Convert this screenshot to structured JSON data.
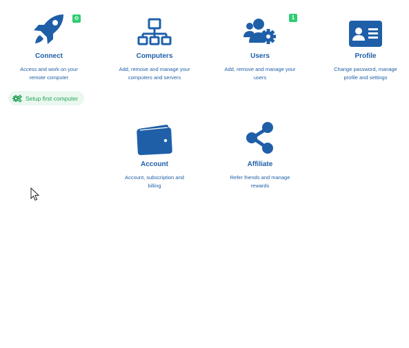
{
  "tiles": {
    "connect": {
      "title": "Connect",
      "desc_line1": "Access and work on your",
      "desc_line2": "remote computer",
      "icon": "rocket-icon",
      "badge": "⚙"
    },
    "computers": {
      "title": "Computers",
      "desc_line1": "Add, remove and manage your",
      "desc_line2": "computers and servers",
      "icon": "network-icon"
    },
    "users": {
      "title": "Users",
      "desc_line1": "Add, remove and manage your",
      "desc_line2": "users",
      "icon": "users-gear-icon",
      "badge": "1"
    },
    "profile": {
      "title": "Profile",
      "desc_line1": "Change password, manage",
      "desc_line2": "profile and settings",
      "icon": "id-card-icon"
    },
    "account": {
      "title": "Account",
      "desc_line1": "Account, subscription and",
      "desc_line2": "billing",
      "icon": "wallet-icon"
    },
    "affiliate": {
      "title": "Affiliate",
      "desc_line1": "Refer friends and manage",
      "desc_line2": "rewards",
      "icon": "share-icon"
    }
  },
  "setup": {
    "label": "Setup first computer",
    "icon": "gears-icon"
  },
  "colors": {
    "primary": "#1f5fa8",
    "badge": "#2ecc71",
    "pill_bg": "#eaf8ef",
    "pill_text": "#27a35a"
  }
}
